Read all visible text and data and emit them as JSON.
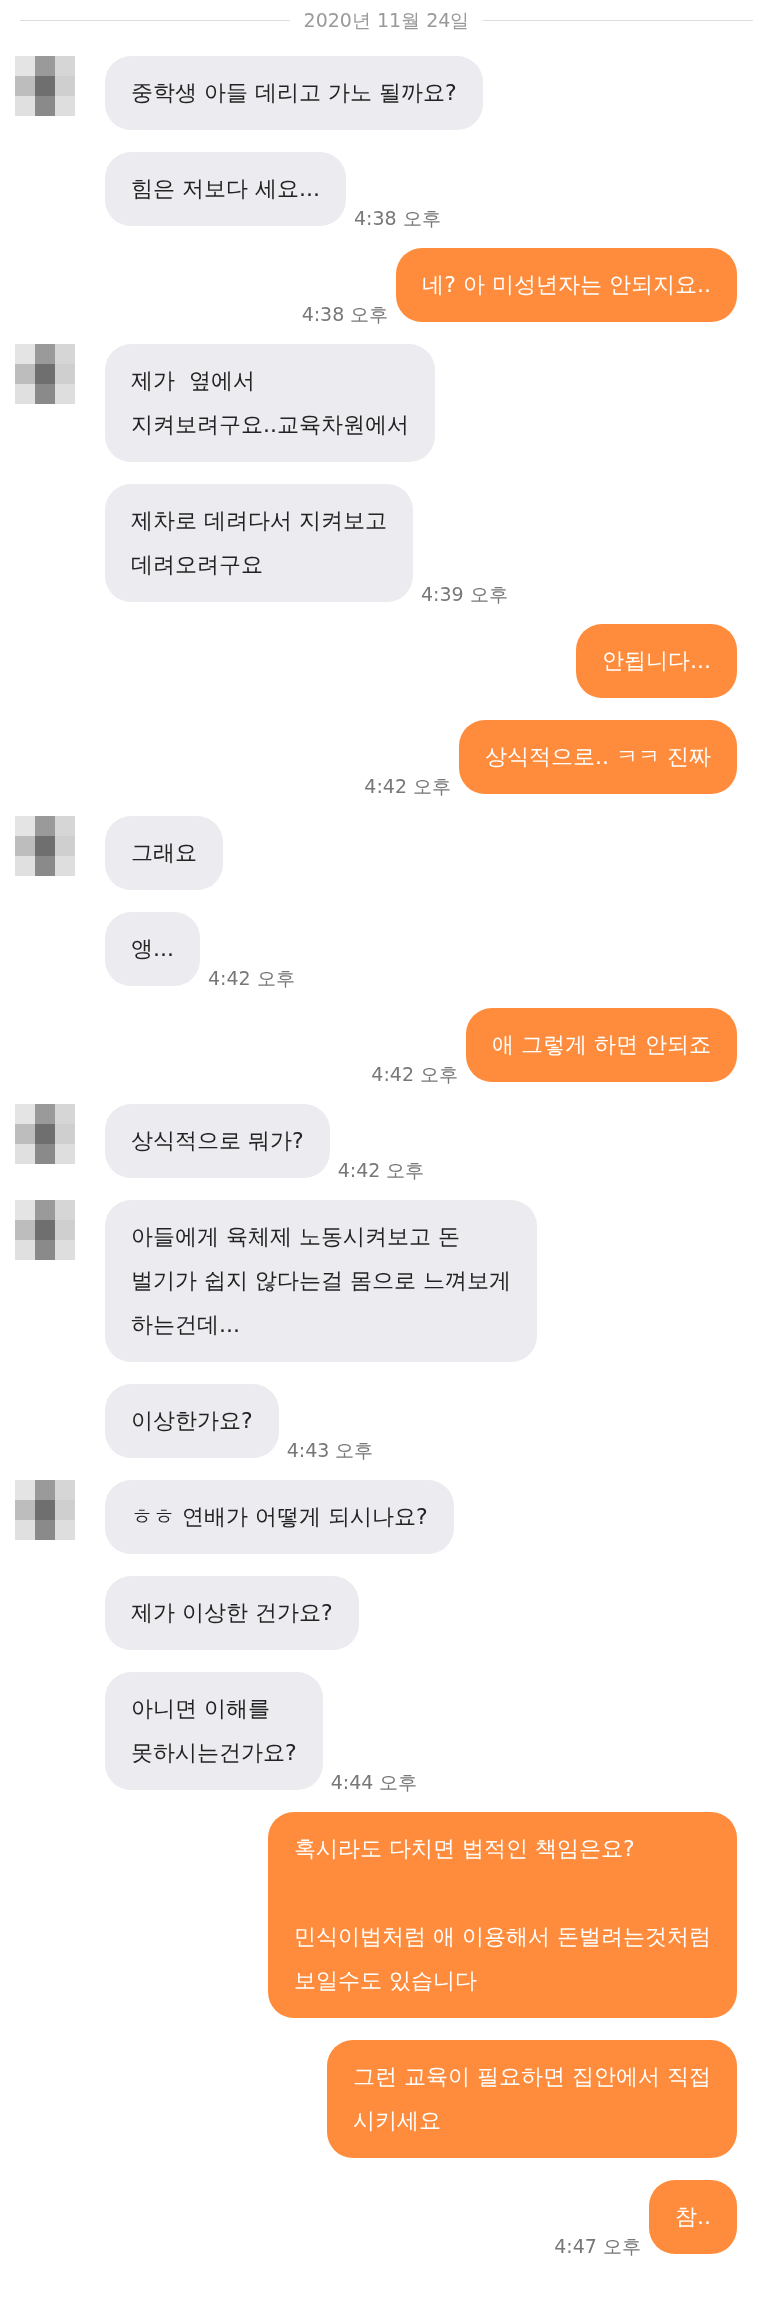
{
  "date": "2020년 11월 24일",
  "messages": [
    {
      "kind": "incoming",
      "avatar": true,
      "text": "중학생 아들 데리고 가노 될까요?"
    },
    {
      "kind": "incoming",
      "avatar": false,
      "text": "힘은 저보다 세요...",
      "time": "4:38 오후"
    },
    {
      "kind": "outgoing",
      "text": "네? 아 미성년자는 안되지요..",
      "time": "4:38 오후"
    },
    {
      "kind": "incoming",
      "avatar": true,
      "text": "제가  옆에서\n지켜보려구요..교육차원에서"
    },
    {
      "kind": "incoming",
      "avatar": false,
      "text": "제차로 데려다서 지켜보고\n데려오려구요",
      "time": "4:39 오후"
    },
    {
      "kind": "outgoing",
      "text": "안됩니다..."
    },
    {
      "kind": "outgoing",
      "text": "상식적으로.. ㅋㅋ 진짜",
      "time": "4:42 오후"
    },
    {
      "kind": "incoming",
      "avatar": true,
      "text": "그래요"
    },
    {
      "kind": "incoming",
      "avatar": false,
      "text": "앵...",
      "time": "4:42 오후"
    },
    {
      "kind": "outgoing",
      "text": "애 그렇게 하면 안되죠",
      "time": "4:42 오후"
    },
    {
      "kind": "incoming",
      "avatar": true,
      "text": "상식적으로 뭐가?",
      "time": "4:42 오후"
    },
    {
      "kind": "incoming",
      "avatar": true,
      "text": "아들에게 육체제 노동시켜보고 돈\n벌기가 쉽지 않다는걸 몸으로 느껴보게\n하는건데..."
    },
    {
      "kind": "incoming",
      "avatar": false,
      "text": "이상한가요?",
      "time": "4:43 오후"
    },
    {
      "kind": "incoming",
      "avatar": true,
      "text": "ㅎㅎ 연배가 어떻게 되시나요?"
    },
    {
      "kind": "incoming",
      "avatar": false,
      "text": "제가 이상한 건가요?"
    },
    {
      "kind": "incoming",
      "avatar": false,
      "text": "아니면 이해를\n못하시는건가요?",
      "time": "4:44 오후"
    },
    {
      "kind": "outgoing",
      "text": "혹시라도 다치면 법적인 책임은요?\n\n민식이법처럼 애 이용해서 돈벌려는것처럼\n보일수도 있습니다"
    },
    {
      "kind": "outgoing",
      "text": "그런 교육이 필요하면 집안에서 직접\n시키세요"
    },
    {
      "kind": "outgoing",
      "text": "참..",
      "time": "4:47 오후"
    }
  ]
}
